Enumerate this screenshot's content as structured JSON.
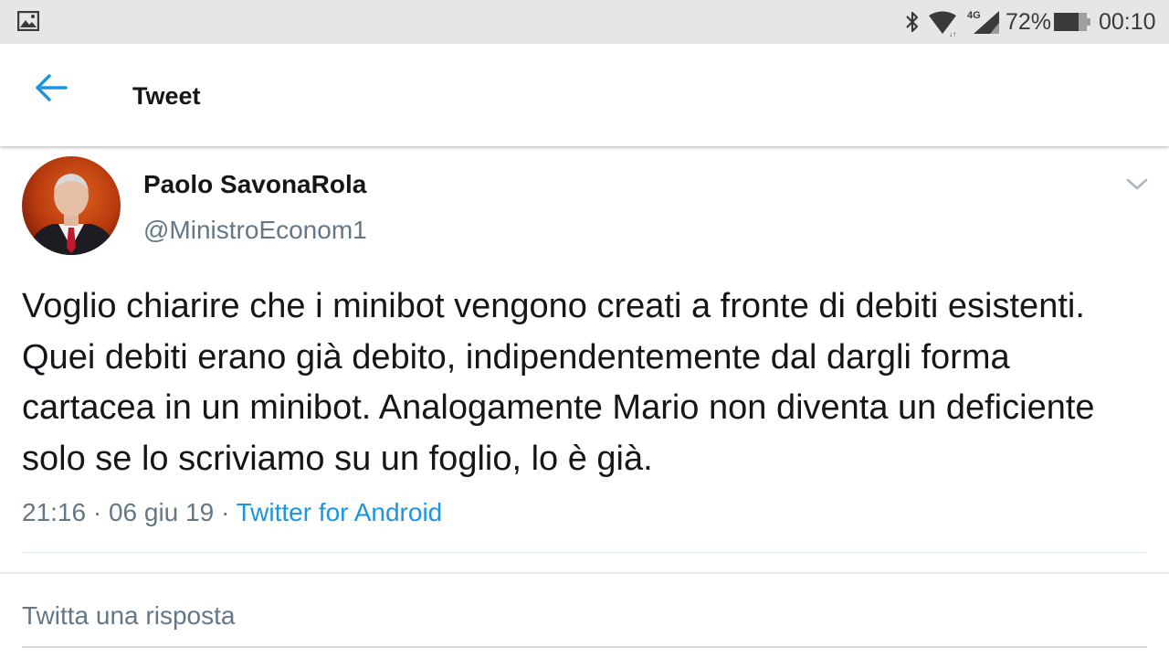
{
  "status_bar": {
    "network": "4G",
    "battery_percent": "72%",
    "time": "00:10",
    "icons": [
      "gallery-icon",
      "bluetooth-icon",
      "wifi-icon",
      "signal-icon",
      "battery-icon"
    ]
  },
  "toolbar": {
    "title": "Tweet",
    "back_icon": "arrow-left-icon"
  },
  "tweet": {
    "display_name": "Paolo SavonaRola",
    "handle": "@MinistroEconom1",
    "text": "Voglio chiarire che i minibot vengono creati a fronte di debiti esistenti. Quei debiti erano già debito, indipendentemente dal dargli forma cartacea in un minibot. Analogamente Mario non diventa un deficiente solo se lo scriviamo su un foglio, lo è  già.",
    "time": "21:16",
    "date": "06 giu 19",
    "separator": "·",
    "source": "Twitter for Android"
  },
  "reply": {
    "placeholder": "Twitta una risposta"
  },
  "colors": {
    "accent": "#1b95e0",
    "secondary_text": "#657786",
    "primary_text": "#14171a",
    "status_bar_bg": "#e6e6e6"
  }
}
